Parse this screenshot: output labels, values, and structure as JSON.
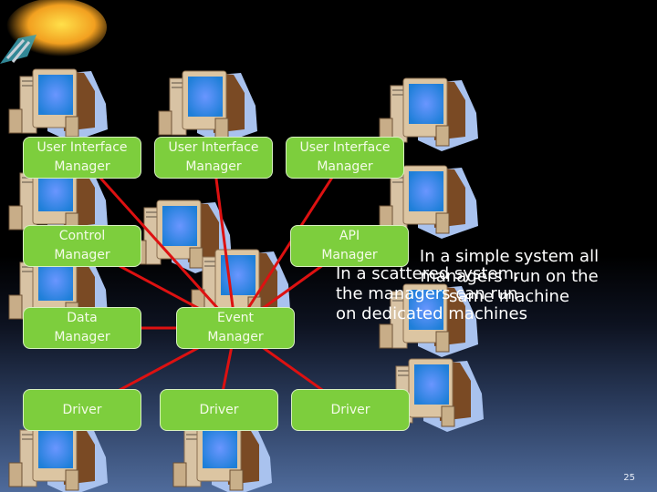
{
  "diagram": {
    "nodes": [
      {
        "id": "ui1",
        "lines": [
          "User Interface",
          "Manager"
        ]
      },
      {
        "id": "ui2",
        "lines": [
          "User Interface",
          "Manager"
        ]
      },
      {
        "id": "ui3",
        "lines": [
          "User Interface",
          "Manager"
        ]
      },
      {
        "id": "control",
        "lines": [
          "Control",
          "Manager"
        ]
      },
      {
        "id": "api",
        "lines": [
          "API",
          "Manager"
        ]
      },
      {
        "id": "data",
        "lines": [
          "Data",
          "Manager"
        ]
      },
      {
        "id": "event",
        "lines": [
          "Event",
          "Manager"
        ]
      },
      {
        "id": "driver1",
        "lines": [
          "Driver"
        ]
      },
      {
        "id": "driver2",
        "lines": [
          "Driver"
        ]
      },
      {
        "id": "driver3",
        "lines": [
          "Driver"
        ]
      }
    ],
    "edges": [
      [
        "ui1",
        "event"
      ],
      [
        "ui2",
        "event"
      ],
      [
        "ui3",
        "event"
      ],
      [
        "control",
        "event"
      ],
      [
        "api",
        "event"
      ],
      [
        "data",
        "event"
      ],
      [
        "event",
        "driver1"
      ],
      [
        "event",
        "driver2"
      ],
      [
        "event",
        "driver3"
      ]
    ],
    "edge_color": "#dd1111",
    "node_color": "#7dce3d"
  },
  "notes": {
    "simple": "In a simple system all\nmanagers  run on the\nsame machine",
    "scattered": "In a scattered system,\nthe managers can run\non dedicated machines"
  },
  "slide_number": "25",
  "decoration": {
    "top_left_image": "comet-icon",
    "computer_count": 12
  }
}
